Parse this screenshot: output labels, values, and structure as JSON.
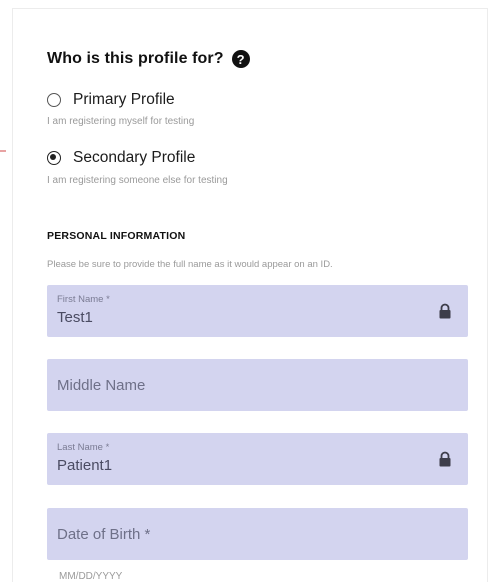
{
  "profile": {
    "question": "Who is this profile for?",
    "help_glyph": "?",
    "options": [
      {
        "label": "Primary Profile",
        "description": "I am registering myself for testing",
        "selected": false
      },
      {
        "label": "Secondary Profile",
        "description": "I am registering someone else for testing",
        "selected": true
      }
    ]
  },
  "personal": {
    "heading": "PERSONAL INFORMATION",
    "note": "Please be sure to provide the full name as it would appear on an ID."
  },
  "fields": {
    "first_name": {
      "label": "First Name *",
      "value": "Test1",
      "locked": true
    },
    "middle_name": {
      "placeholder": "Middle Name"
    },
    "last_name": {
      "label": "Last Name *",
      "value": "Patient1",
      "locked": true
    },
    "dob": {
      "placeholder": "Date of Birth *",
      "helper": "MM/DD/YYYY"
    }
  },
  "icons": {
    "help": "help-icon",
    "lock": "lock-icon"
  },
  "colors": {
    "field_background": "#d3d4ef",
    "text_primary": "#111111",
    "text_muted": "#9a9a9a"
  }
}
